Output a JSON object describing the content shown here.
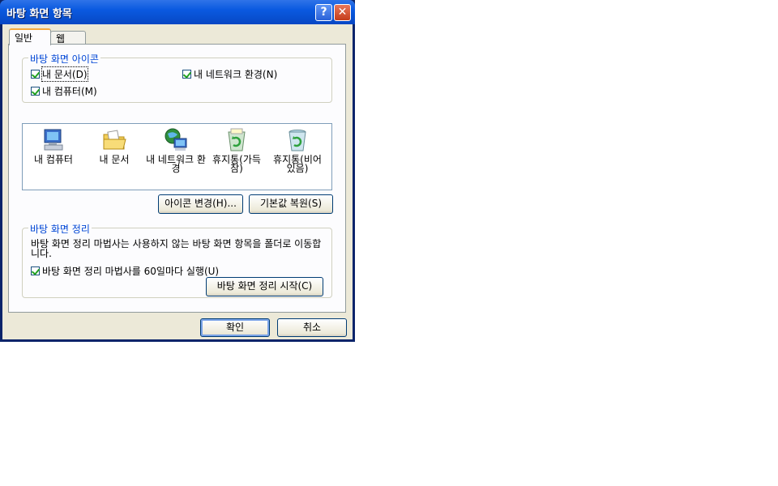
{
  "window": {
    "title": "바탕 화면 항목"
  },
  "tabs": {
    "general": "일반",
    "web": "웹"
  },
  "icons_group": {
    "legend": "바탕 화면 아이콘",
    "checkboxes": {
      "my_documents": "내 문서(D)",
      "my_network": "내 네트워크 환경(N)",
      "my_computer": "내 컴퓨터(M)"
    }
  },
  "icon_list": [
    {
      "label": "내 컴퓨터",
      "icon": "computer-icon"
    },
    {
      "label": "내 문서",
      "icon": "folder-icon"
    },
    {
      "label": "내 네트워크 환경",
      "icon": "network-icon"
    },
    {
      "label": "휴지통(가득 참)",
      "icon": "recycle-bin-full-icon"
    },
    {
      "label": "휴지통(비어 있음)",
      "icon": "recycle-bin-empty-icon"
    }
  ],
  "icon_buttons": {
    "change_icon": "아이콘 변경(H)...",
    "restore_default": "기본값 복원(S)"
  },
  "cleanup_group": {
    "legend": "바탕 화면 정리",
    "description": "바탕 화면 정리 마법사는 사용하지 않는 바탕 화면 항목을 폴더로 이동합니다.",
    "run_checkbox": "바탕 화면 정리 마법사를 60일마다 실행(U)",
    "start_button": "바탕 화면 정리 시작(C)"
  },
  "footer": {
    "ok": "확인",
    "cancel": "취소"
  },
  "colors": {
    "title_blue": "#0a5ae0",
    "face": "#ece9d8",
    "legend_blue": "#0046d5"
  }
}
